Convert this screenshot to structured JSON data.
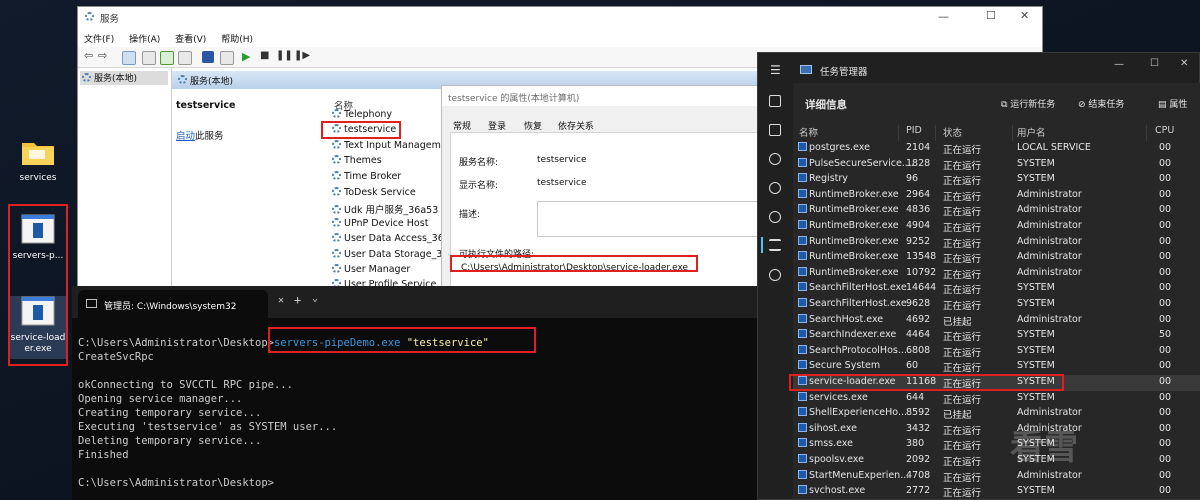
{
  "desktop": {
    "icons": [
      {
        "label": "services"
      },
      {
        "label": "servers-p..."
      },
      {
        "label": "service-load er.exe"
      }
    ]
  },
  "services_window": {
    "title": "服务",
    "menu": [
      "文件(F)",
      "操作(A)",
      "查看(V)",
      "帮助(H)"
    ],
    "tree_root": "服务(本地)",
    "header": "服务(本地)",
    "selected_name": "testservice",
    "start_link": "启动",
    "start_suffix": "此服务",
    "column_name": "名称",
    "services": [
      "Telephony",
      "testservice",
      "Text Input Managem",
      "Themes",
      "Time Broker",
      "ToDesk Service",
      "Udk 用户服务_36a53",
      "UPnP Device Host",
      "User Data Access_36a",
      "User Data Storage_36a",
      "User Manager",
      "User Profile Service"
    ]
  },
  "properties_dialog": {
    "title": "testservice 的属性(本地计算机)",
    "tabs": [
      "常规",
      "登录",
      "恢复",
      "依存关系"
    ],
    "service_name_label": "服务名称:",
    "service_name_value": "testservice",
    "display_name_label": "显示名称:",
    "display_name_value": "testservice",
    "description_label": "描述:",
    "exe_path_label": "可执行文件的路径:",
    "exe_path_value": "C:\\Users\\Administrator\\Desktop\\service-loader.exe"
  },
  "cmd": {
    "tab_title": "管理员: C:\\Windows\\system32",
    "prompt": "C:\\Users\\Administrator\\Desktop>",
    "command": "servers-pipeDemo.exe",
    "argument": "\"testservice\"",
    "output": [
      "CreateSvcRpc",
      "",
      "okConnecting to SVCCTL RPC pipe...",
      "Opening service manager...",
      "Creating temporary service...",
      "Executing 'testservice' as SYSTEM user...",
      "Deleting temporary service...",
      "Finished",
      ""
    ],
    "final_prompt": "C:\\Users\\Administrator\\Desktop>"
  },
  "task_manager": {
    "title": "任务管理器",
    "section": "详细信息",
    "actions": {
      "run_new": "运行新任务",
      "end_task": "结束任务",
      "properties": "属性"
    },
    "columns": [
      "名称",
      "PID",
      "状态",
      "用户名",
      "CPU"
    ],
    "rows": [
      {
        "name": "postgres.exe",
        "pid": "2104",
        "status": "正在运行",
        "user": "LOCAL SERVICE",
        "cpu": "00"
      },
      {
        "name": "PulseSecureService....",
        "pid": "1828",
        "status": "正在运行",
        "user": "SYSTEM",
        "cpu": "00"
      },
      {
        "name": "Registry",
        "pid": "96",
        "status": "正在运行",
        "user": "SYSTEM",
        "cpu": "00"
      },
      {
        "name": "RuntimeBroker.exe",
        "pid": "2964",
        "status": "正在运行",
        "user": "Administrator",
        "cpu": "00"
      },
      {
        "name": "RuntimeBroker.exe",
        "pid": "4836",
        "status": "正在运行",
        "user": "Administrator",
        "cpu": "00"
      },
      {
        "name": "RuntimeBroker.exe",
        "pid": "4904",
        "status": "正在运行",
        "user": "Administrator",
        "cpu": "00"
      },
      {
        "name": "RuntimeBroker.exe",
        "pid": "9252",
        "status": "正在运行",
        "user": "Administrator",
        "cpu": "00"
      },
      {
        "name": "RuntimeBroker.exe",
        "pid": "13548",
        "status": "正在运行",
        "user": "Administrator",
        "cpu": "00"
      },
      {
        "name": "RuntimeBroker.exe",
        "pid": "10792",
        "status": "正在运行",
        "user": "Administrator",
        "cpu": "00"
      },
      {
        "name": "SearchFilterHost.exe",
        "pid": "14644",
        "status": "正在运行",
        "user": "SYSTEM",
        "cpu": "00"
      },
      {
        "name": "SearchFilterHost.exe",
        "pid": "9628",
        "status": "正在运行",
        "user": "SYSTEM",
        "cpu": "00"
      },
      {
        "name": "SearchHost.exe",
        "pid": "4692",
        "status": "已挂起",
        "user": "Administrator",
        "cpu": "00"
      },
      {
        "name": "SearchIndexer.exe",
        "pid": "4464",
        "status": "正在运行",
        "user": "SYSTEM",
        "cpu": "50"
      },
      {
        "name": "SearchProtocolHos...",
        "pid": "6808",
        "status": "正在运行",
        "user": "SYSTEM",
        "cpu": "00"
      },
      {
        "name": "Secure System",
        "pid": "60",
        "status": "正在运行",
        "user": "SYSTEM",
        "cpu": "00"
      },
      {
        "name": "service-loader.exe",
        "pid": "11168",
        "status": "正在运行",
        "user": "SYSTEM",
        "cpu": "00"
      },
      {
        "name": "services.exe",
        "pid": "644",
        "status": "正在运行",
        "user": "SYSTEM",
        "cpu": "00"
      },
      {
        "name": "ShellExperienceHo...",
        "pid": "8592",
        "status": "已挂起",
        "user": "Administrator",
        "cpu": "00"
      },
      {
        "name": "sihost.exe",
        "pid": "3432",
        "status": "正在运行",
        "user": "Administrator",
        "cpu": "00"
      },
      {
        "name": "smss.exe",
        "pid": "380",
        "status": "正在运行",
        "user": "SYSTEM",
        "cpu": "00"
      },
      {
        "name": "spoolsv.exe",
        "pid": "2092",
        "status": "正在运行",
        "user": "SYSTEM",
        "cpu": "00"
      },
      {
        "name": "StartMenuExperien...",
        "pid": "4708",
        "status": "正在运行",
        "user": "Administrator",
        "cpu": "00"
      },
      {
        "name": "svchost.exe",
        "pid": "2772",
        "status": "正在运行",
        "user": "SYSTEM",
        "cpu": "00"
      }
    ]
  },
  "watermark": "看雪",
  "colors": {
    "highlight_red": "#e02020",
    "cmd_command": "#3a96dd",
    "cmd_string": "#f9f1a5"
  }
}
